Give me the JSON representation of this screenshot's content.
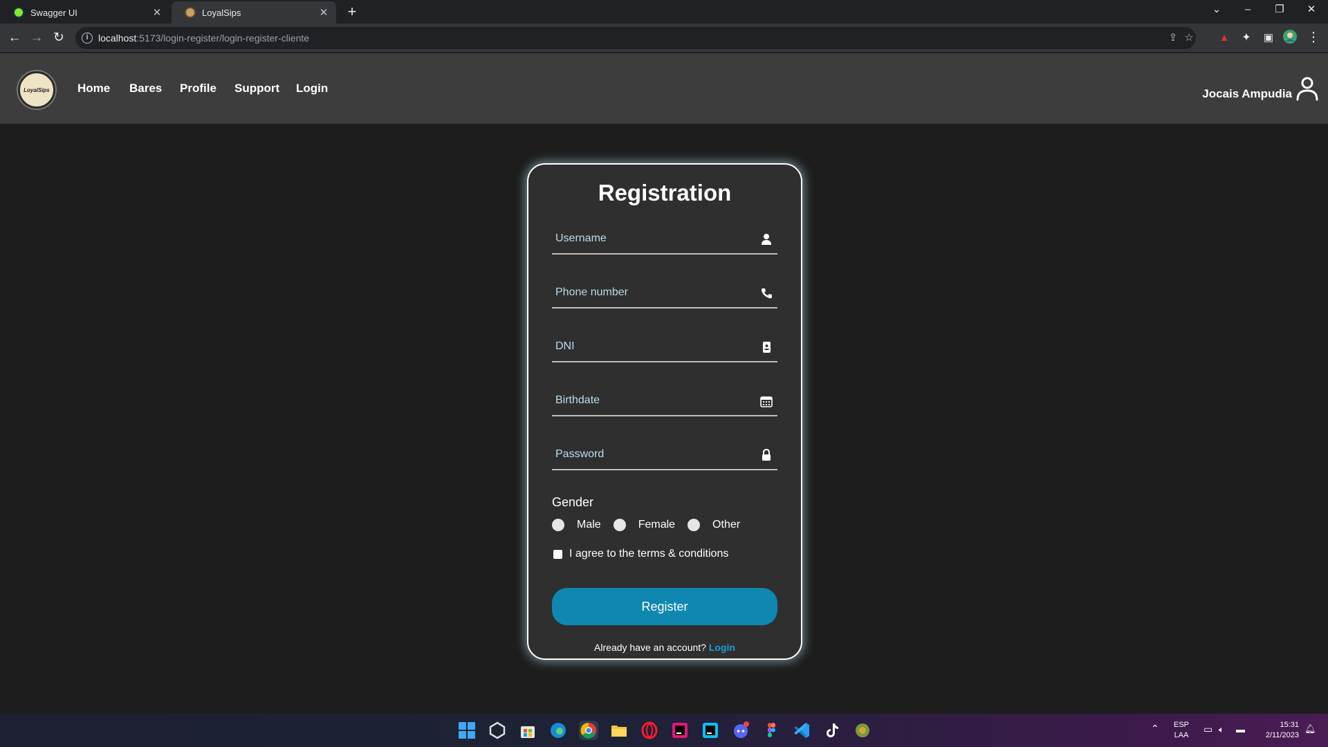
{
  "browser": {
    "tabs": [
      {
        "title": "Swagger UI",
        "active": false
      },
      {
        "title": "LoyalSips",
        "active": true
      }
    ],
    "url_host": "localhost",
    "url_rest": ":5173/login-register/login-register-cliente"
  },
  "navbar": {
    "logo_text": "LoyalSips",
    "links": [
      "Home",
      "Bares",
      "Profile",
      "Support",
      "Login"
    ],
    "user_name": "Jocais Ampudia"
  },
  "form": {
    "title": "Registration",
    "fields": [
      {
        "placeholder": "Username",
        "icon": "user-icon"
      },
      {
        "placeholder": "Phone number",
        "icon": "phone-icon"
      },
      {
        "placeholder": "DNI",
        "icon": "id-card-icon"
      },
      {
        "placeholder": "Birthdate",
        "icon": "calendar-icon"
      },
      {
        "placeholder": "Password",
        "icon": "lock-icon"
      }
    ],
    "gender_label": "Gender",
    "gender_options": [
      "Male",
      "Female",
      "Other"
    ],
    "terms_label": "I agree to the terms & conditions",
    "register_label": "Register",
    "login_prompt": "Already have an account?",
    "login_link": "Login"
  },
  "taskbar": {
    "language": "ESP",
    "layout": "LAA",
    "time": "15:31",
    "date": "2/11/2023"
  },
  "colors": {
    "accent": "#0f87b1",
    "link": "#1b9fd6",
    "card_glow": "#aad7e6"
  }
}
